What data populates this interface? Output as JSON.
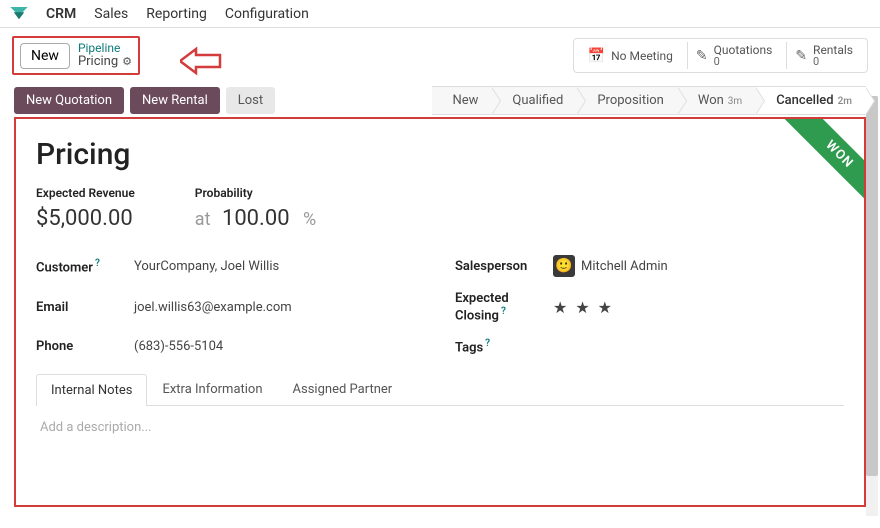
{
  "topbar": {
    "brand": "CRM",
    "menu": [
      "Sales",
      "Reporting",
      "Configuration"
    ]
  },
  "header": {
    "new_button": "New",
    "breadcrumb": {
      "pipeline": "Pipeline",
      "current": "Pricing"
    },
    "stats": {
      "meeting": "No Meeting",
      "quotations_label": "Quotations",
      "quotations_count": "0",
      "rentals_label": "Rentals",
      "rentals_count": "0"
    }
  },
  "actions": {
    "new_quotation": "New Quotation",
    "new_rental": "New Rental",
    "lost": "Lost"
  },
  "stages": [
    {
      "label": "New",
      "time": ""
    },
    {
      "label": "Qualified",
      "time": ""
    },
    {
      "label": "Proposition",
      "time": ""
    },
    {
      "label": "Won",
      "time": "3m"
    },
    {
      "label": "Cancelled",
      "time": "2m"
    }
  ],
  "ribbon": "WON",
  "record": {
    "title": "Pricing",
    "expected_revenue_label": "Expected Revenue",
    "expected_revenue": "$5,000.00",
    "probability_label": "Probability",
    "at": "at",
    "probability": "100.00",
    "pct": "%",
    "customer_label": "Customer",
    "customer": "YourCompany, Joel Willis",
    "email_label": "Email",
    "email": "joel.willis63@example.com",
    "phone_label": "Phone",
    "phone": "(683)-556-5104",
    "salesperson_label": "Salesperson",
    "salesperson": "Mitchell Admin",
    "closing_label": "Expected Closing",
    "tags_label": "Tags",
    "priority_stars": 3
  },
  "tabs": [
    "Internal Notes",
    "Extra Information",
    "Assigned Partner"
  ],
  "description_placeholder": "Add a description..."
}
